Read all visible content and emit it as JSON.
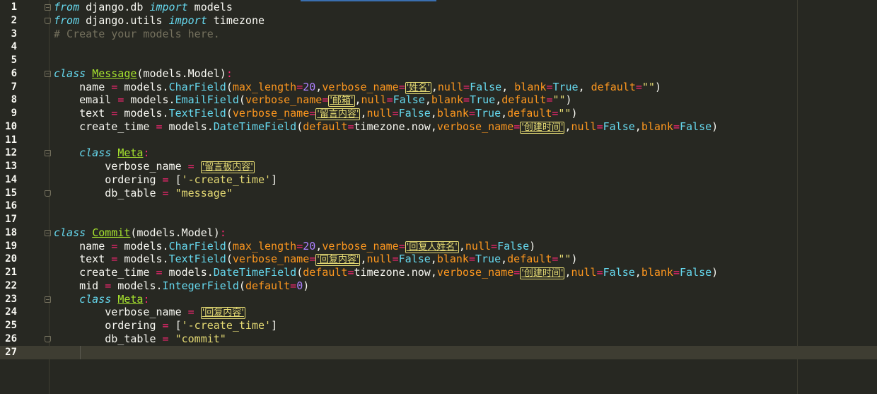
{
  "lines": [
    {
      "num": "1",
      "tokens": [
        [
          "kw",
          "from"
        ],
        [
          "plain",
          " django.db "
        ],
        [
          "kw",
          "import"
        ],
        [
          "plain",
          " models"
        ]
      ]
    },
    {
      "num": "2",
      "tokens": [
        [
          "kw",
          "from"
        ],
        [
          "plain",
          " django.utils "
        ],
        [
          "kw",
          "import"
        ],
        [
          "plain",
          " timezone"
        ]
      ]
    },
    {
      "num": "3",
      "tokens": [
        [
          "cm",
          "# Create your models here."
        ]
      ]
    },
    {
      "num": "4",
      "tokens": []
    },
    {
      "num": "5",
      "tokens": []
    },
    {
      "num": "6",
      "tokens": [
        [
          "kw",
          "class"
        ],
        [
          "plain",
          " "
        ],
        [
          "cls",
          "Message"
        ],
        [
          "plain",
          "(models.Model)"
        ],
        [
          "op",
          ":"
        ]
      ]
    },
    {
      "num": "7",
      "tokens": [
        [
          "plain",
          "    name "
        ],
        [
          "op",
          "="
        ],
        [
          "plain",
          " models."
        ],
        [
          "fn",
          "CharField"
        ],
        [
          "plain",
          "("
        ],
        [
          "arg",
          "max_length"
        ],
        [
          "op",
          "="
        ],
        [
          "num",
          "20"
        ],
        [
          "plain",
          ","
        ],
        [
          "arg",
          "verbose_name"
        ],
        [
          "op",
          "="
        ],
        [
          "strhl",
          "'姓名'"
        ],
        [
          "plain",
          ","
        ],
        [
          "arg",
          "null"
        ],
        [
          "op",
          "="
        ],
        [
          "const",
          "False"
        ],
        [
          "plain",
          ", "
        ],
        [
          "arg",
          "blank"
        ],
        [
          "op",
          "="
        ],
        [
          "const",
          "True"
        ],
        [
          "plain",
          ", "
        ],
        [
          "arg",
          "default"
        ],
        [
          "op",
          "="
        ],
        [
          "str",
          "\"\""
        ],
        [
          "plain",
          ")"
        ]
      ]
    },
    {
      "num": "8",
      "tokens": [
        [
          "plain",
          "    email "
        ],
        [
          "op",
          "="
        ],
        [
          "plain",
          " models."
        ],
        [
          "fn",
          "EmailField"
        ],
        [
          "plain",
          "("
        ],
        [
          "arg",
          "verbose_name"
        ],
        [
          "op",
          "="
        ],
        [
          "strhl",
          "'邮箱'"
        ],
        [
          "plain",
          ","
        ],
        [
          "arg",
          "null"
        ],
        [
          "op",
          "="
        ],
        [
          "const",
          "False"
        ],
        [
          "plain",
          ","
        ],
        [
          "arg",
          "blank"
        ],
        [
          "op",
          "="
        ],
        [
          "const",
          "True"
        ],
        [
          "plain",
          ","
        ],
        [
          "arg",
          "default"
        ],
        [
          "op",
          "="
        ],
        [
          "str",
          "\"\""
        ],
        [
          "plain",
          ")"
        ]
      ]
    },
    {
      "num": "9",
      "tokens": [
        [
          "plain",
          "    text "
        ],
        [
          "op",
          "="
        ],
        [
          "plain",
          " models."
        ],
        [
          "fn",
          "TextField"
        ],
        [
          "plain",
          "("
        ],
        [
          "arg",
          "verbose_name"
        ],
        [
          "op",
          "="
        ],
        [
          "strhl",
          "'留言内容'"
        ],
        [
          "plain",
          ","
        ],
        [
          "arg",
          "null"
        ],
        [
          "op",
          "="
        ],
        [
          "const",
          "False"
        ],
        [
          "plain",
          ","
        ],
        [
          "arg",
          "blank"
        ],
        [
          "op",
          "="
        ],
        [
          "const",
          "True"
        ],
        [
          "plain",
          ","
        ],
        [
          "arg",
          "default"
        ],
        [
          "op",
          "="
        ],
        [
          "str",
          "\"\""
        ],
        [
          "plain",
          ")"
        ]
      ]
    },
    {
      "num": "10",
      "tokens": [
        [
          "plain",
          "    create_time "
        ],
        [
          "op",
          "="
        ],
        [
          "plain",
          " models."
        ],
        [
          "fn",
          "DateTimeField"
        ],
        [
          "plain",
          "("
        ],
        [
          "arg",
          "default"
        ],
        [
          "op",
          "="
        ],
        [
          "plain",
          "timezone.now,"
        ],
        [
          "arg",
          "verbose_name"
        ],
        [
          "op",
          "="
        ],
        [
          "strhl",
          "'创建时间'"
        ],
        [
          "plain",
          ","
        ],
        [
          "arg",
          "null"
        ],
        [
          "op",
          "="
        ],
        [
          "const",
          "False"
        ],
        [
          "plain",
          ","
        ],
        [
          "arg",
          "blank"
        ],
        [
          "op",
          "="
        ],
        [
          "const",
          "False"
        ],
        [
          "plain",
          ")"
        ]
      ]
    },
    {
      "num": "11",
      "tokens": []
    },
    {
      "num": "12",
      "tokens": [
        [
          "plain",
          "    "
        ],
        [
          "kw",
          "class"
        ],
        [
          "plain",
          " "
        ],
        [
          "cls",
          "Meta"
        ],
        [
          "op",
          ":"
        ]
      ]
    },
    {
      "num": "13",
      "tokens": [
        [
          "plain",
          "        verbose_name "
        ],
        [
          "op",
          "="
        ],
        [
          "plain",
          " "
        ],
        [
          "strhl",
          "'留言板内容'"
        ]
      ]
    },
    {
      "num": "14",
      "tokens": [
        [
          "plain",
          "        ordering "
        ],
        [
          "op",
          "="
        ],
        [
          "plain",
          " ["
        ],
        [
          "str",
          "'-create_time'"
        ],
        [
          "plain",
          "]"
        ]
      ]
    },
    {
      "num": "15",
      "tokens": [
        [
          "plain",
          "        db_table "
        ],
        [
          "op",
          "="
        ],
        [
          "plain",
          " "
        ],
        [
          "str",
          "\"message\""
        ]
      ]
    },
    {
      "num": "16",
      "tokens": []
    },
    {
      "num": "17",
      "tokens": []
    },
    {
      "num": "18",
      "tokens": [
        [
          "kw",
          "class"
        ],
        [
          "plain",
          " "
        ],
        [
          "cls",
          "Commit"
        ],
        [
          "plain",
          "(models.Model)"
        ],
        [
          "op",
          ":"
        ]
      ]
    },
    {
      "num": "19",
      "tokens": [
        [
          "plain",
          "    name "
        ],
        [
          "op",
          "="
        ],
        [
          "plain",
          " models."
        ],
        [
          "fn",
          "CharField"
        ],
        [
          "plain",
          "("
        ],
        [
          "arg",
          "max_length"
        ],
        [
          "op",
          "="
        ],
        [
          "num",
          "20"
        ],
        [
          "plain",
          ","
        ],
        [
          "arg",
          "verbose_name"
        ],
        [
          "op",
          "="
        ],
        [
          "strhl",
          "'回复人姓名'"
        ],
        [
          "plain",
          ","
        ],
        [
          "arg",
          "null"
        ],
        [
          "op",
          "="
        ],
        [
          "const",
          "False"
        ],
        [
          "plain",
          ")"
        ]
      ]
    },
    {
      "num": "20",
      "tokens": [
        [
          "plain",
          "    text "
        ],
        [
          "op",
          "="
        ],
        [
          "plain",
          " models."
        ],
        [
          "fn",
          "TextField"
        ],
        [
          "plain",
          "("
        ],
        [
          "arg",
          "verbose_name"
        ],
        [
          "op",
          "="
        ],
        [
          "strhl",
          "'回复内容'"
        ],
        [
          "plain",
          ","
        ],
        [
          "arg",
          "null"
        ],
        [
          "op",
          "="
        ],
        [
          "const",
          "False"
        ],
        [
          "plain",
          ","
        ],
        [
          "arg",
          "blank"
        ],
        [
          "op",
          "="
        ],
        [
          "const",
          "True"
        ],
        [
          "plain",
          ","
        ],
        [
          "arg",
          "default"
        ],
        [
          "op",
          "="
        ],
        [
          "str",
          "\"\""
        ],
        [
          "plain",
          ")"
        ]
      ]
    },
    {
      "num": "21",
      "tokens": [
        [
          "plain",
          "    create_time "
        ],
        [
          "op",
          "="
        ],
        [
          "plain",
          " models."
        ],
        [
          "fn",
          "DateTimeField"
        ],
        [
          "plain",
          "("
        ],
        [
          "arg",
          "default"
        ],
        [
          "op",
          "="
        ],
        [
          "plain",
          "timezone.now,"
        ],
        [
          "arg",
          "verbose_name"
        ],
        [
          "op",
          "="
        ],
        [
          "strhl",
          "'创建时间'"
        ],
        [
          "plain",
          ","
        ],
        [
          "arg",
          "null"
        ],
        [
          "op",
          "="
        ],
        [
          "const",
          "False"
        ],
        [
          "plain",
          ","
        ],
        [
          "arg",
          "blank"
        ],
        [
          "op",
          "="
        ],
        [
          "const",
          "False"
        ],
        [
          "plain",
          ")"
        ]
      ]
    },
    {
      "num": "22",
      "tokens": [
        [
          "plain",
          "    mid "
        ],
        [
          "op",
          "="
        ],
        [
          "plain",
          " models."
        ],
        [
          "fn",
          "IntegerField"
        ],
        [
          "plain",
          "("
        ],
        [
          "arg",
          "default"
        ],
        [
          "op",
          "="
        ],
        [
          "num",
          "0"
        ],
        [
          "plain",
          ")"
        ]
      ]
    },
    {
      "num": "23",
      "tokens": [
        [
          "plain",
          "    "
        ],
        [
          "kw",
          "class"
        ],
        [
          "plain",
          " "
        ],
        [
          "cls",
          "Meta"
        ],
        [
          "op",
          ":"
        ]
      ]
    },
    {
      "num": "24",
      "tokens": [
        [
          "plain",
          "        verbose_name "
        ],
        [
          "op",
          "="
        ],
        [
          "plain",
          " "
        ],
        [
          "strhl",
          "'回复内容'"
        ]
      ]
    },
    {
      "num": "25",
      "tokens": [
        [
          "plain",
          "        ordering "
        ],
        [
          "op",
          "="
        ],
        [
          "plain",
          " ["
        ],
        [
          "str",
          "'-create_time'"
        ],
        [
          "plain",
          "]"
        ]
      ]
    },
    {
      "num": "26",
      "tokens": [
        [
          "plain",
          "        db_table "
        ],
        [
          "op",
          "="
        ],
        [
          "plain",
          " "
        ],
        [
          "str",
          "\"commit\""
        ]
      ]
    },
    {
      "num": "27",
      "tokens": []
    }
  ],
  "folds": [
    {
      "line": "1",
      "kind": "open"
    },
    {
      "line": "2",
      "kind": "end"
    },
    {
      "line": "6",
      "kind": "open"
    },
    {
      "line": "12",
      "kind": "open"
    },
    {
      "line": "15",
      "kind": "end"
    },
    {
      "line": "18",
      "kind": "open"
    },
    {
      "line": "23",
      "kind": "open"
    },
    {
      "line": "26",
      "kind": "end"
    }
  ],
  "colors": {
    "background": "#272822",
    "keyword": "#66d9ef",
    "class_name": "#a6e22e",
    "string": "#e6db74",
    "operator": "#f92672",
    "number": "#ae81ff",
    "argument": "#fd971f",
    "comment": "#75715e"
  }
}
